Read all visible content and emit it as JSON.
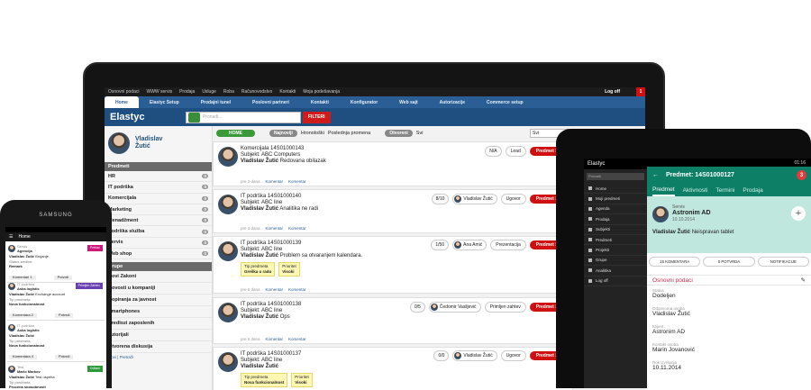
{
  "laptop": {
    "topnav": [
      "Osnovni podaci",
      "WWW servis",
      "Prodaja",
      "Usluge",
      "Roba",
      "Računovodstvo",
      "Kontakti",
      "Moja podešavanja"
    ],
    "logout": "Log off",
    "notif": "1",
    "tabs": [
      "Home",
      "Elastyc Setup",
      "Prodajni tunel",
      "Poslovni partneri",
      "Kontakti",
      "Konfigurator",
      "Web sajt",
      "Autorizacije",
      "Commerce setup"
    ],
    "logo": "Elastyc",
    "search_placeholder": "Pronađi...",
    "filter_btn": "FILTERI",
    "user": {
      "first": "Vladislav",
      "last": "Žutić"
    },
    "sidebar_header": "Predmeti",
    "sidebar": [
      {
        "label": "HR",
        "count": "0"
      },
      {
        "label": "IT podrška",
        "count": "0"
      },
      {
        "label": "Komercijala",
        "count": "0"
      },
      {
        "label": "Marketing",
        "count": "0"
      },
      {
        "label": "Menadžment",
        "count": "0"
      },
      {
        "label": "Podrška služba",
        "count": "0"
      },
      {
        "label": "Servis",
        "count": "0"
      },
      {
        "label": "Web shop",
        "count": "0"
      }
    ],
    "sidebar_header2": "Grupe",
    "sidebar2": [
      "Novi Zakoni",
      "Novosti u kompaniji",
      "Kopiranja za javnost",
      "Smartphones",
      "Predlozi zaposlenih",
      "Tutorijali",
      "Otvorena diskusija"
    ],
    "sidebar_footer": "Novi | Pretraži",
    "filters": {
      "home": "HOME",
      "hr": "Hronološki",
      "last": "Poslednja promena",
      "open": "Otvoreni",
      "all": "Svi",
      "najnoviji": "Najnoviji",
      "select": "Svi"
    },
    "cards": [
      {
        "l1": "Komercijala 14S01000143",
        "l2": "Subjekt: ABC Computers",
        "name": "Vladislav Žutić",
        "msg": "Redovana obilazak",
        "meta": "pre 2 dana",
        "kom": "Komentar",
        "kom2": "Komentar",
        "cnt": "N/A",
        "btn": "Lead",
        "red": "Predmet >>"
      },
      {
        "l1": "IT podrška 14S01000140",
        "l2": "Subjekt: ABC line",
        "name": "Vladislav Žutić",
        "msg": "Analitika ne radi",
        "meta": "pre 4 dana",
        "kom": "Komentar",
        "kom2": "Komentar",
        "cnt": "8/10",
        "user": "Vladislav Žutić",
        "btn": "Ugovor",
        "red": "Predmet >>"
      },
      {
        "l1": "IT podrška 14S01000139",
        "l2": "Subjekt: ABC line",
        "name": "Vladislav Žutić",
        "msg": "Problem sa otvaranjem kalendara.",
        "meta": "pre 5 dana",
        "kom": "Komentar",
        "kom2": "Komentar",
        "cnt": "1/50",
        "user": "Ana Amić",
        "btn": "Prezentacija",
        "red": "Predmet >>",
        "tags": [
          [
            "Tip predmeta",
            "Greška u radu"
          ],
          [
            "Prioritet",
            "Visoki"
          ]
        ]
      },
      {
        "l1": "IT podrška 14S01000138",
        "l2": "Subjekt: ABC line",
        "name": "Vladislav Žutić",
        "msg": "Ops",
        "meta": "pre 5 dana",
        "kom": "Komentar",
        "kom2": "Komentar",
        "cnt": "0/5",
        "user": "Čedomir Vasiljević",
        "btn": "Primljen zahtev",
        "red": "Predmet >>"
      },
      {
        "l1": "IT podrška 14S01000137",
        "l2": "Subjekt: ABC line",
        "name": "Vladislav Žutić",
        "msg": "",
        "meta": "",
        "cnt": "0/0",
        "user": "Vladislav Žutić",
        "btn": "Ugovor",
        "red": "Predmet >>",
        "tags": [
          [
            "Tip predmeta",
            "Nova funkcionalnost"
          ],
          [
            "Prioritet",
            "Visoki"
          ]
        ]
      }
    ]
  },
  "tablet": {
    "time": "01:16",
    "logo": "Elastyc",
    "search": "Pronađi",
    "side": [
      "Home",
      "Moji predmeti",
      "Agenda",
      "Prodaja",
      "Subjekti",
      "Predmeti",
      "Projekti",
      "Grupe",
      "Analitika",
      "Log off"
    ],
    "title": "Predmet: 14S01000127",
    "badge": "3",
    "tabs": [
      "Predmet",
      "Aktivnosti",
      "Termini",
      "Prodaja"
    ],
    "card": {
      "type": "Servis",
      "company": "Astronim AD",
      "date": "10.10.2014",
      "name": "Vladislav Žutić",
      "msg": "Neispravan tablet"
    },
    "btns": [
      "15 KOMENTARA",
      "0 POTVRDA",
      "NOTIFIKACIJE"
    ],
    "section": "Osnovni podaci",
    "fields": [
      [
        "Status",
        "Dodeljen"
      ],
      [
        "Odgovorna osoba",
        "Vladislav Žutić"
      ],
      [
        "Klijent",
        "Astronim AD"
      ],
      [
        "Kontakt osoba",
        "Marin Jovanović"
      ],
      [
        "Rok izvršenja",
        "10.11.2014"
      ]
    ]
  },
  "phone": {
    "brand": "SAMSUNG",
    "home": "Home",
    "cards": [
      {
        "cat": "Servis",
        "sub": "Agencija",
        "name": "Vladislav Žutić",
        "msg": "Brujanje",
        "red": "Prebac",
        "l1": "Status sredine",
        "l2": "Remark",
        "k": "Komentari 1",
        "p": "Potvrdi"
      },
      {
        "cat": "IT podrška",
        "sub": "Aska logistic",
        "name": "Vladislav Žutić",
        "msg": "Exchange account",
        "red": "Primljen Zahtev",
        "l1": "Tip predmeta",
        "l2": "Nova funkcionalnost",
        "k": "Komentara 2",
        "p": "Potvrdi"
      },
      {
        "cat": "IT podrška",
        "sub": "Aska logistic",
        "name": "Vladislav Žutić",
        "msg": "",
        "red": "",
        "l1": "Tip predmeta",
        "l2": "Nova funkcionalnost",
        "k": "Komentara 4",
        "p": "Potvrdi"
      },
      {
        "cat": "Test",
        "sub": "Mario Markov",
        "name": "Vladislav Žutić",
        "msg": "Test uspeha",
        "red": "Odbaci",
        "l1": "Tip predmeta",
        "l2": "Procena sposobnosti",
        "k": "",
        "p": ""
      }
    ]
  }
}
